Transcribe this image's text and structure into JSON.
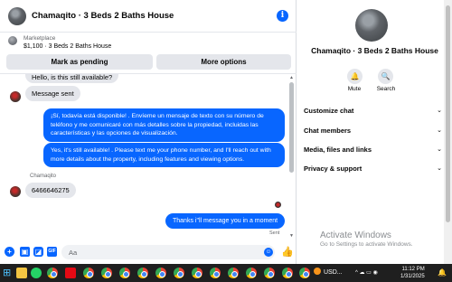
{
  "header": {
    "title": "Chamaqito · 3 Beds 2 Baths House",
    "info_icon": "info-icon"
  },
  "marketplace": {
    "label": "Marketplace",
    "listing": "$1,100 · 3 Beds 2 Baths House",
    "mark_pending": "Mark as pending",
    "more_options": "More options"
  },
  "messages": {
    "hello": "Hello, is this still available?",
    "message_sent": "Message sent",
    "spanish": "¡Sí, todavía está disponible! . Envíeme un mensaje de texto con su número de teléfono y me comunicaré con más detalles sobre la propiedad, incluidas las características y las opciones de visualización.",
    "english": "Yes, it's still available! . Please text me your phone number, and I'll reach out with more details about the property, including features and viewing options.",
    "sender_name": "Chamaqito",
    "phone": "6466646275",
    "reply": "Thanks i\"ll message you in a moment",
    "status": "Sent"
  },
  "composer": {
    "placeholder": "Aa"
  },
  "details": {
    "title": "Chamaqito · 3 Beds 2 Baths House",
    "mute": "Mute",
    "search": "Search",
    "sections": [
      "Customize chat",
      "Chat members",
      "Media, files and links",
      "Privacy & support"
    ]
  },
  "watermark": {
    "title": "Activate Windows",
    "subtitle": "Go to Settings to activate Windows."
  },
  "taskbar": {
    "stock": "USD...",
    "time": "11:12 PM",
    "date": "1/31/2025",
    "tray": "^ ☁ ▭ ◉"
  },
  "colors": {
    "accent": "#0866ff",
    "bubble_in": "#e4e6eb",
    "taskbar": "#1f1f1f"
  }
}
